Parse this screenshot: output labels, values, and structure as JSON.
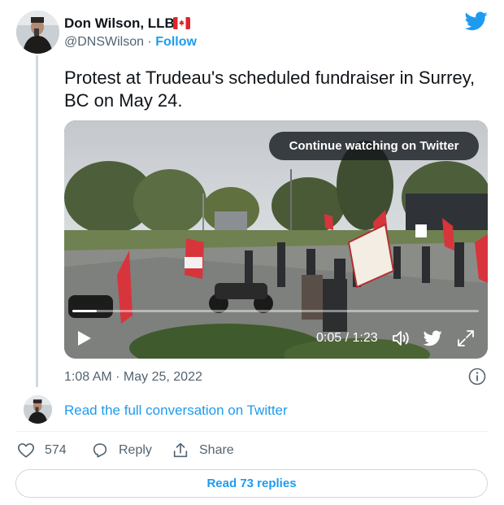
{
  "author": {
    "name": "Don Wilson, LLB",
    "flag_icon": "canada-flag-icon",
    "handle": "@DNSWilson",
    "separator": "·",
    "follow_label": "Follow"
  },
  "brand": {
    "logo_icon": "twitter-bird-icon",
    "color": "#1d9bf0"
  },
  "tweet": {
    "text": "Protest at Trudeau's scheduled fundraiser in Surrey, BC on May 24.",
    "timestamp": "1:08 AM · May 25, 2022"
  },
  "video": {
    "continue_label": "Continue watching on Twitter",
    "time": "0:05 / 1:23",
    "progress": 0.06,
    "icons": [
      "play-icon",
      "volume-icon",
      "twitter-bird-icon",
      "fullscreen-icon"
    ]
  },
  "conversation": {
    "read_label": "Read the full conversation on Twitter"
  },
  "actions": {
    "likes": "574",
    "reply_label": "Reply",
    "share_label": "Share"
  },
  "replies_button": "Read 73 replies",
  "colors": {
    "text": "#0f1419",
    "secondary": "#536471",
    "link": "#1d9bf0",
    "border": "#cfd9de",
    "flag_red": "#e0242b"
  }
}
